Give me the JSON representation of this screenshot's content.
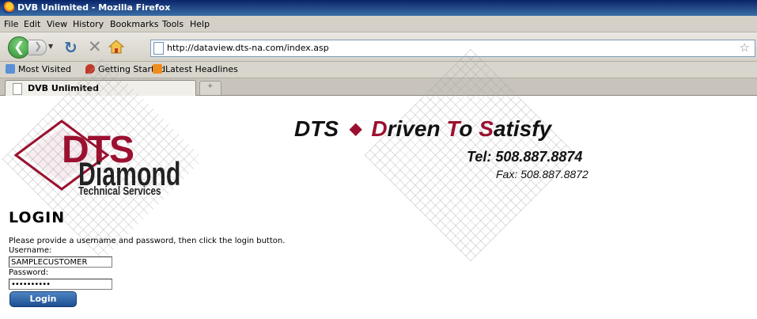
{
  "window": {
    "title": "DVB Unlimited - Mozilla Firefox"
  },
  "menu": [
    "File",
    "Edit",
    "View",
    "History",
    "Bookmarks",
    "Tools",
    "Help"
  ],
  "nav": {
    "url": "http://dataview.dts-na.com/index.asp"
  },
  "bookmarks": [
    "Most Visited",
    "Getting Started",
    "Latest Headlines"
  ],
  "tab": {
    "label": "DVB Unlimited"
  },
  "header": {
    "logo_top": "DTS",
    "logo_mid": "Diamond",
    "logo_bottom": "Technical Services",
    "tagline_dts": "DTS",
    "tagline_d": "D",
    "tagline_riven": "riven ",
    "tagline_t": "T",
    "tagline_o": "o ",
    "tagline_s": "S",
    "tagline_atisfy": "atisfy",
    "tel": "Tel: 508.887.8874",
    "fax": "Fax: 508.887.8872"
  },
  "login": {
    "heading": "LOGIN",
    "instructions": "Please provide a username and password, then click the login button.",
    "username_label": "Username:",
    "username_value": "SAMPLECUSTOMER",
    "password_label": "Password:",
    "password_value": "••••••••••",
    "button_label": "Login"
  },
  "colors": {
    "brand_red": "#9b1030",
    "button_blue": "#2a5ea8"
  }
}
